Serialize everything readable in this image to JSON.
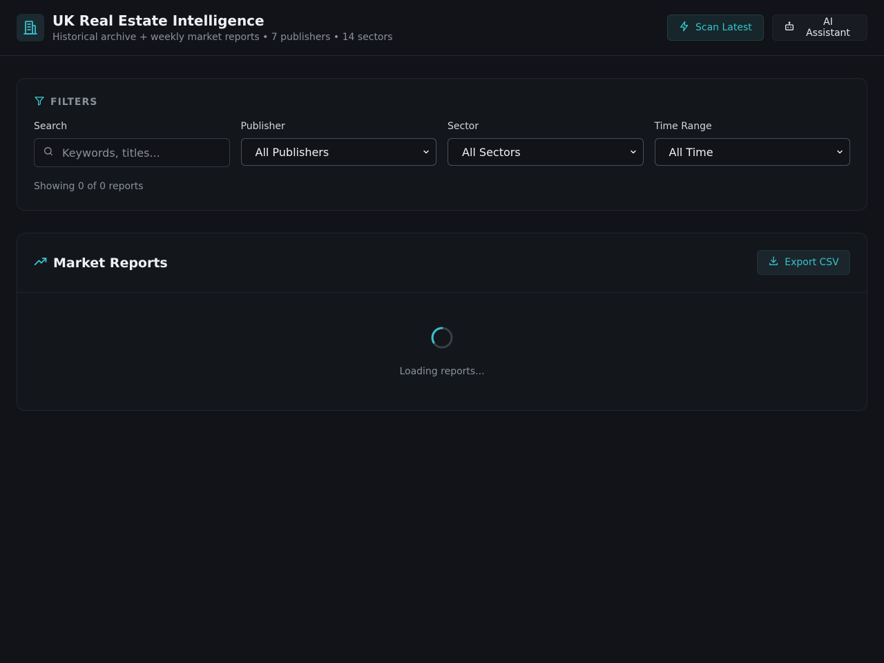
{
  "header": {
    "title": "UK Real Estate Intelligence",
    "subtitle": "Historical archive + weekly market reports • 7 publishers • 14 sectors",
    "logo_icon": "building-icon",
    "scan_label": "Scan Latest",
    "ai_label": "AI Assistant"
  },
  "filters": {
    "heading": "FILTERS",
    "search_label": "Search",
    "search_placeholder": "Keywords, titles...",
    "publisher_label": "Publisher",
    "publisher_value": "All Publishers",
    "sector_label": "Sector",
    "sector_value": "All Sectors",
    "time_label": "Time Range",
    "time_value": "All Time",
    "showing_text": "Showing 0 of 0 reports"
  },
  "reports": {
    "title": "Market Reports",
    "export_label": "Export CSV",
    "loading_text": "Loading reports..."
  },
  "colors": {
    "accent": "#38c2cc",
    "background": "#111318",
    "card": "#13161b"
  }
}
